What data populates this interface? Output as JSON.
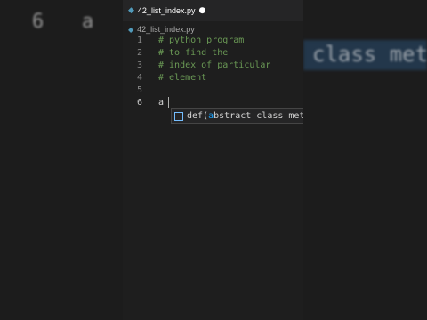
{
  "background": {
    "left_line_number": "6",
    "left_char": "a",
    "right_text": "class met"
  },
  "tab": {
    "icon": "python-file-icon",
    "filename": "42_list_index.py",
    "unsaved_dot": "●"
  },
  "breadcrumb": {
    "icon": "python-file-icon",
    "filename": "42_list_index.py"
  },
  "lines": [
    {
      "num": "1",
      "text": "# python program"
    },
    {
      "num": "2",
      "text": "# to find the"
    },
    {
      "num": "3",
      "text": "# index of particular"
    },
    {
      "num": "4",
      "text": "# element"
    },
    {
      "num": "5",
      "text": ""
    },
    {
      "num": "6",
      "text": "a"
    }
  ],
  "suggestion": {
    "icon": "snippet-icon",
    "prefix": "def(",
    "match": "a",
    "rest": "bstract class met"
  },
  "colors": {
    "comment": "#6a9955",
    "editor_bg": "#1e1e1e",
    "match_highlight": "#18a3ff",
    "python_icon": "#519aba"
  }
}
